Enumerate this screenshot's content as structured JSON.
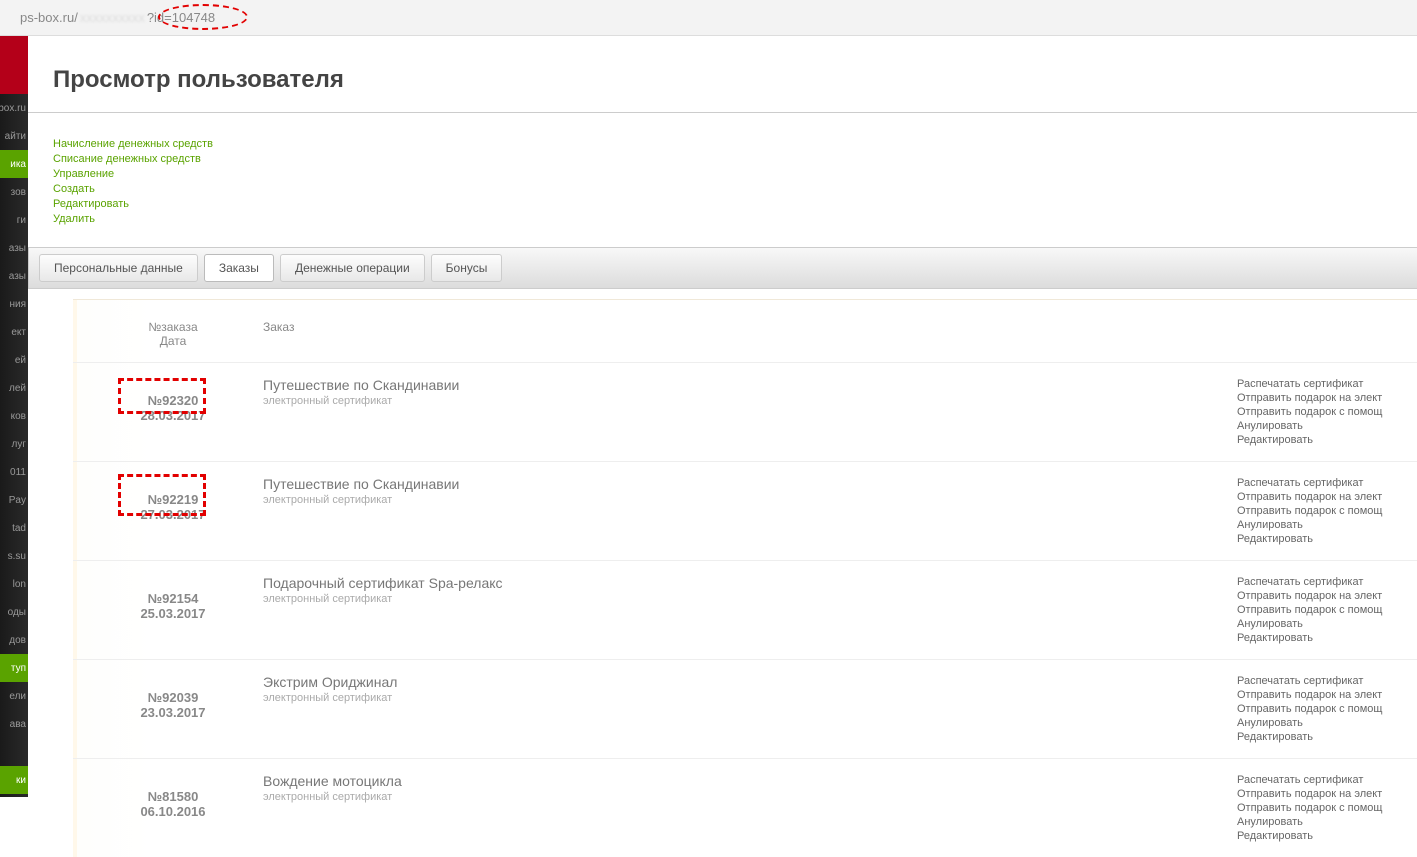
{
  "url": {
    "domain": "ps-box.ru/",
    "blur": "xxxxxxxxxx",
    "query": "?id=104748"
  },
  "sidebar": {
    "logo_text": "",
    "items": [
      {
        "label": "box.ru",
        "active": false
      },
      {
        "label": "айти",
        "active": false
      },
      {
        "label": "ика",
        "active": true
      },
      {
        "label": "зов",
        "active": false
      },
      {
        "label": "ги",
        "active": false
      },
      {
        "label": "азы",
        "active": false
      },
      {
        "label": "азы",
        "active": false
      },
      {
        "label": "ния",
        "active": false
      },
      {
        "label": "ект",
        "active": false
      },
      {
        "label": "ей",
        "active": false
      },
      {
        "label": "лей",
        "active": false
      },
      {
        "label": "ков",
        "active": false
      },
      {
        "label": "луг",
        "active": false
      },
      {
        "label": "011",
        "active": false
      },
      {
        "label": "Pay",
        "active": false
      },
      {
        "label": "tad",
        "active": false
      },
      {
        "label": "s.su",
        "active": false
      },
      {
        "label": "lon",
        "active": false
      },
      {
        "label": "оды",
        "active": false
      },
      {
        "label": "дов",
        "active": false
      },
      {
        "label": "туп",
        "active": true
      },
      {
        "label": "ели",
        "active": false
      },
      {
        "label": "ава",
        "active": false
      },
      {
        "label": "",
        "active": false
      },
      {
        "label": "ки",
        "active": true
      }
    ]
  },
  "page": {
    "title": "Просмотр пользователя"
  },
  "action_links": [
    "Начисление денежных средств",
    "Списание денежных средств",
    "Управление",
    "Создать",
    "Редактировать",
    "Удалить"
  ],
  "tabs": [
    {
      "label": "Персональные данные",
      "active": false
    },
    {
      "label": "Заказы",
      "active": true
    },
    {
      "label": "Денежные операции",
      "active": false
    },
    {
      "label": "Бонусы",
      "active": false
    }
  ],
  "orders": {
    "header": {
      "id": "№заказа",
      "date": "Дата",
      "order": "Заказ"
    },
    "actions_labels": {
      "print": "Распечатать сертификат",
      "send_email": "Отправить подарок на элект",
      "send_help": "Отправить подарок с помощ",
      "cancel": "Анулировать",
      "edit": "Редактировать"
    },
    "rows": [
      {
        "num": "№92320",
        "date": "28.03.2017",
        "title": "Путешествие по Скандинавии",
        "sub": "электронный сертификат"
      },
      {
        "num": "№92219",
        "date": "27.03.2017",
        "title": "Путешествие по Скандинавии",
        "sub": "электронный сертификат"
      },
      {
        "num": "№92154",
        "date": "25.03.2017",
        "title": "Подарочный сертификат Spa-релакс",
        "sub": "электронный сертификат"
      },
      {
        "num": "№92039",
        "date": "23.03.2017",
        "title": "Экстрим Ориджинал",
        "sub": "электронный сертификат"
      },
      {
        "num": "№81580",
        "date": "06.10.2016",
        "title": "Вождение мотоцикла",
        "sub": "электронный сертификат"
      }
    ]
  }
}
